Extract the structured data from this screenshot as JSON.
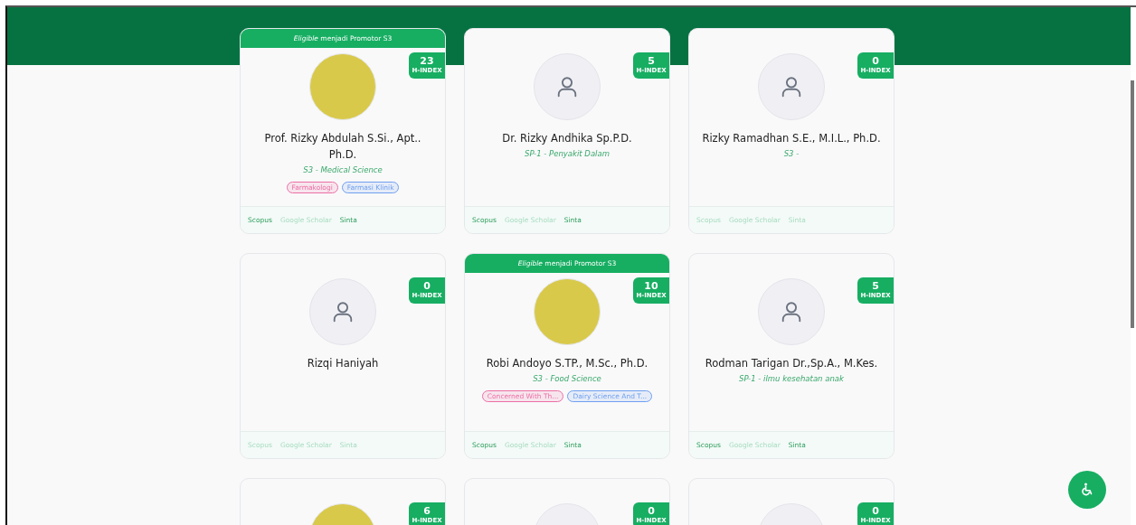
{
  "cards": [
    {
      "banner": "*Eligible* menjadi Promotor S3",
      "kind": "photo",
      "h_index": "23",
      "h_index_label": "H-INDEX",
      "name": "Prof. Rizky Abdulah S.Si., Apt.. Ph.D.",
      "program": "S3 - Medical Science",
      "tags": [
        {
          "label": "Farmakologi",
          "color": "#ec6fa5"
        },
        {
          "label": "Farmasi Klinik",
          "color": "#6f9ff0"
        }
      ],
      "links": [
        {
          "label": "Scopus",
          "available": true
        },
        {
          "label": "Google Scholar",
          "available": false
        },
        {
          "label": "Sinta",
          "available": true
        }
      ]
    },
    {
      "kind": "placeholder",
      "h_index": "5",
      "h_index_label": "H-INDEX",
      "name": "Dr. Rizky Andhika Sp.P.D.",
      "program": "SP-1 - Penyakit Dalam",
      "links": [
        {
          "label": "Scopus",
          "available": true
        },
        {
          "label": "Google Scholar",
          "available": false
        },
        {
          "label": "Sinta",
          "available": true
        }
      ]
    },
    {
      "kind": "placeholder",
      "h_index": "0",
      "h_index_label": "H-INDEX",
      "name": "Rizky Ramadhan S.E., M.I.L., Ph.D.",
      "program": "S3 -",
      "links": [
        {
          "label": "Scopus",
          "available": false
        },
        {
          "label": "Google Scholar",
          "available": false
        },
        {
          "label": "Sinta",
          "available": false
        }
      ]
    },
    {
      "kind": "placeholder",
      "h_index": "0",
      "h_index_label": "H-INDEX",
      "name": "Rizqi Haniyah",
      "links": [
        {
          "label": "Scopus",
          "available": false
        },
        {
          "label": "Google Scholar",
          "available": false
        },
        {
          "label": "Sinta",
          "available": false
        }
      ]
    },
    {
      "banner": "*Eligible* menjadi Promotor S3",
      "kind": "photo",
      "h_index": "10",
      "h_index_label": "H-INDEX",
      "name": "Robi Andoyo S.TP., M.Sc., Ph.D.",
      "program": "S3 - Food Science",
      "tags": [
        {
          "label": "Concerned With Th...",
          "color": "#ec6fa5"
        },
        {
          "label": "Dairy Science And T...",
          "color": "#6f9ff0"
        }
      ],
      "links": [
        {
          "label": "Scopus",
          "available": true
        },
        {
          "label": "Google Scholar",
          "available": false
        },
        {
          "label": "Sinta",
          "available": true
        }
      ]
    },
    {
      "kind": "placeholder",
      "h_index": "5",
      "h_index_label": "H-INDEX",
      "name": "Rodman Tarigan Dr.,Sp.A., M.Kes.",
      "program": "SP-1 - ilmu kesehatan anak",
      "links": [
        {
          "label": "Scopus",
          "available": true
        },
        {
          "label": "Google Scholar",
          "available": false
        },
        {
          "label": "Sinta",
          "available": true
        }
      ]
    },
    {
      "kind": "photo",
      "h_index": "6",
      "h_index_label": "H-INDEX"
    },
    {
      "kind": "placeholder",
      "h_index": "0",
      "h_index_label": "H-INDEX"
    },
    {
      "kind": "placeholder",
      "h_index": "0",
      "h_index_label": "H-INDEX"
    }
  ]
}
